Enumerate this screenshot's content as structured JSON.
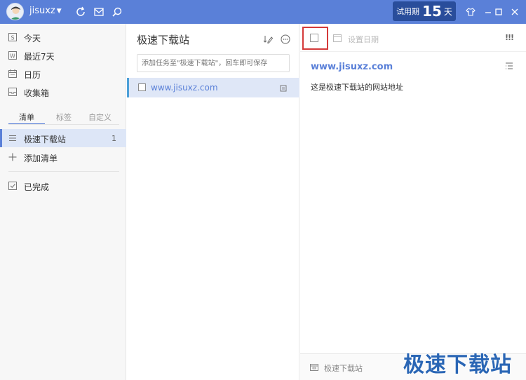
{
  "titlebar": {
    "username": "jisuxz",
    "trial_label": "试用期",
    "trial_days": "15",
    "trial_unit": "天"
  },
  "sidebar": {
    "smart_lists": [
      {
        "label": "今天",
        "icon": "calendar-s-icon"
      },
      {
        "label": "最近7天",
        "icon": "calendar-w-icon"
      },
      {
        "label": "日历",
        "icon": "calendar-icon"
      },
      {
        "label": "收集箱",
        "icon": "inbox-icon"
      }
    ],
    "tabs": [
      "清单",
      "标签",
      "自定义"
    ],
    "lists": [
      {
        "label": "极速下载站",
        "count": "1"
      }
    ],
    "add_list": "添加清单",
    "completed": "已完成"
  },
  "middle": {
    "title": "极速下载站",
    "add_placeholder": "添加任务至\"极速下载站\"，回车即可保存",
    "tasks": [
      {
        "text": "www.jisuxz.com"
      }
    ]
  },
  "detail": {
    "set_date": "设置日期",
    "priority": "!!!",
    "title": "www.jisuxz.com",
    "description": "这是极速下载站的网站地址",
    "list_name": "极速下载站"
  },
  "watermark": "极速下载站",
  "colors": {
    "titlebar": "#5a80d8",
    "trial_bg": "#294d9b",
    "selected": "#dde6f7",
    "accent": "#5a80d8",
    "highlight_box": "#d43a3a"
  }
}
